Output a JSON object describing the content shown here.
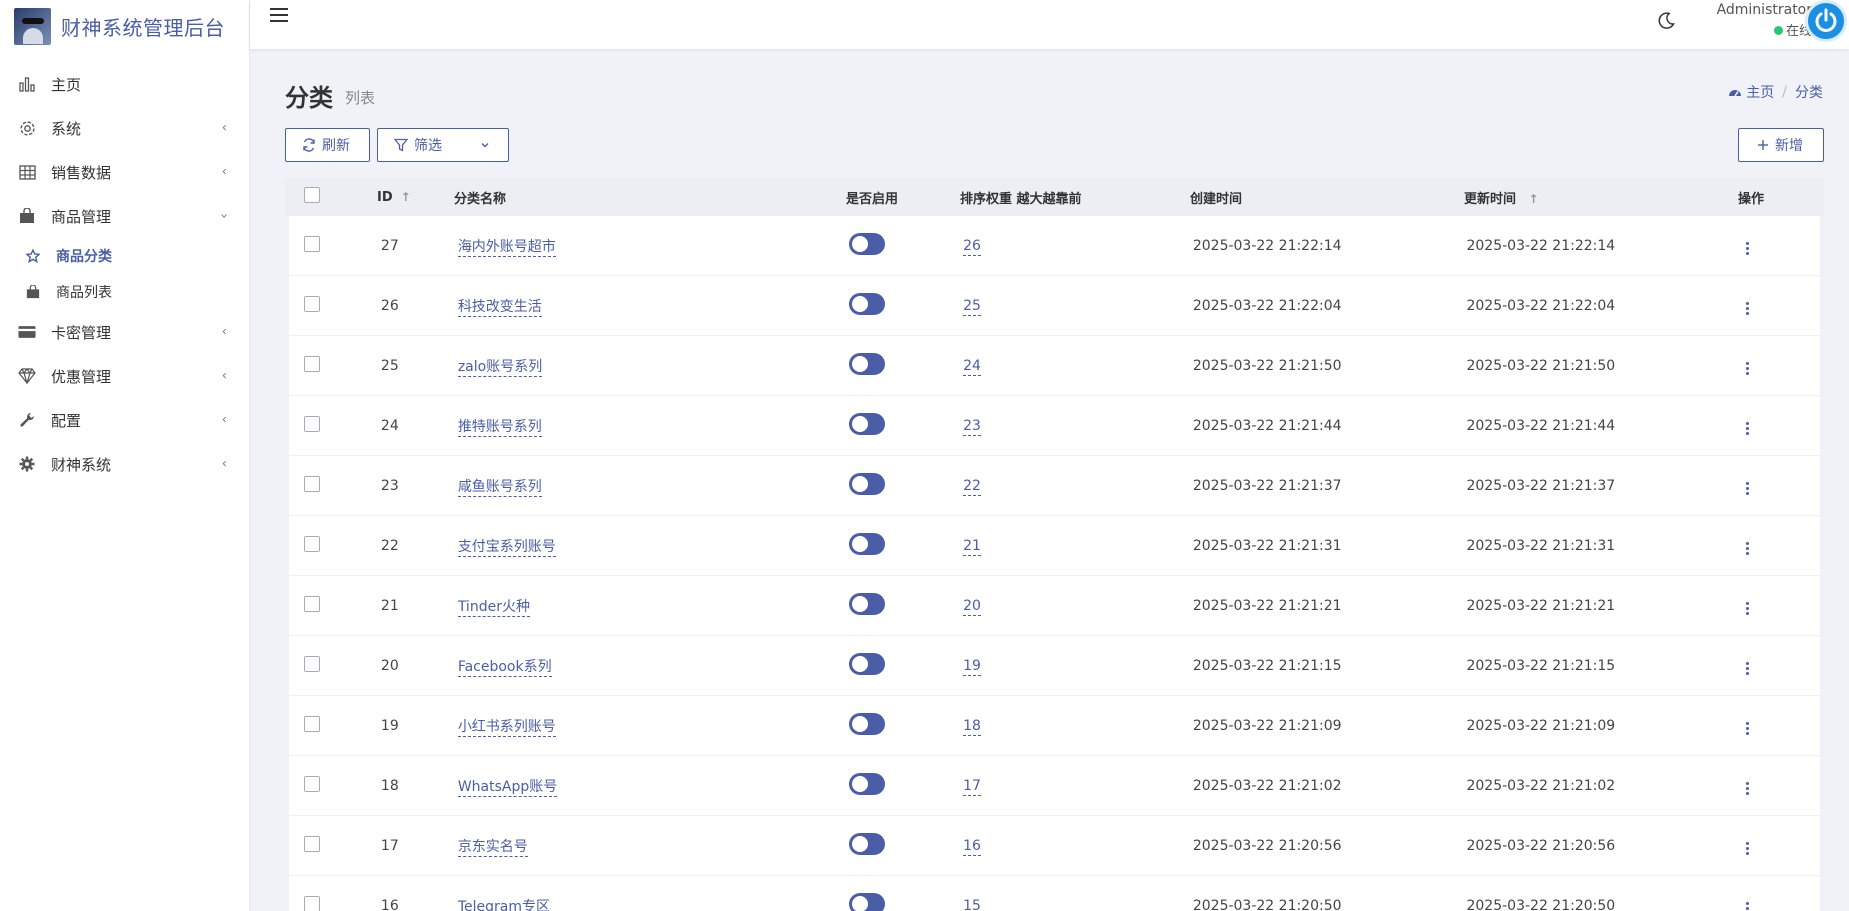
{
  "brand": {
    "title": "财神系统管理后台"
  },
  "sidebar": {
    "items": [
      {
        "label": "主页",
        "icon": "bar-chart-icon",
        "expandable": false
      },
      {
        "label": "系统",
        "icon": "gear-icon",
        "expandable": true
      },
      {
        "label": "销售数据",
        "icon": "table-icon",
        "expandable": true
      },
      {
        "label": "商品管理",
        "icon": "shopping-bag-icon",
        "expandable": true,
        "expanded": true,
        "children": [
          {
            "label": "商品分类",
            "icon": "star-icon",
            "active": true
          },
          {
            "label": "商品列表",
            "icon": "bag-icon",
            "active": false
          }
        ]
      },
      {
        "label": "卡密管理",
        "icon": "credit-card-icon",
        "expandable": true
      },
      {
        "label": "优惠管理",
        "icon": "diamond-icon",
        "expandable": true
      },
      {
        "label": "配置",
        "icon": "wrench-icon",
        "expandable": true
      },
      {
        "label": "财神系统",
        "icon": "cog-icon",
        "expandable": true
      }
    ]
  },
  "header": {
    "user_name": "Administrator",
    "user_status": "在线",
    "status_color": "#28c76f"
  },
  "page": {
    "title": "分类",
    "subtitle": "列表",
    "breadcrumb": {
      "home": "主页",
      "current": "分类"
    }
  },
  "toolbar": {
    "refresh_label": "刷新",
    "filter_label": "筛选",
    "add_label": "新增"
  },
  "table": {
    "headers": {
      "id": "ID",
      "name": "分类名称",
      "enabled": "是否启用",
      "sort": "排序权重 越大越靠前",
      "created": "创建时间",
      "updated": "更新时间",
      "ops": "操作"
    },
    "rows": [
      {
        "id": "27",
        "name": "海内外账号超市",
        "enabled": true,
        "sort": "26",
        "created": "2025-03-22 21:22:14",
        "updated": "2025-03-22 21:22:14"
      },
      {
        "id": "26",
        "name": "科技改变生活",
        "enabled": true,
        "sort": "25",
        "created": "2025-03-22 21:22:04",
        "updated": "2025-03-22 21:22:04"
      },
      {
        "id": "25",
        "name": "zalo账号系列",
        "enabled": true,
        "sort": "24",
        "created": "2025-03-22 21:21:50",
        "updated": "2025-03-22 21:21:50"
      },
      {
        "id": "24",
        "name": "推特账号系列",
        "enabled": true,
        "sort": "23",
        "created": "2025-03-22 21:21:44",
        "updated": "2025-03-22 21:21:44"
      },
      {
        "id": "23",
        "name": "咸鱼账号系列",
        "enabled": true,
        "sort": "22",
        "created": "2025-03-22 21:21:37",
        "updated": "2025-03-22 21:21:37"
      },
      {
        "id": "22",
        "name": "支付宝系列账号",
        "enabled": true,
        "sort": "21",
        "created": "2025-03-22 21:21:31",
        "updated": "2025-03-22 21:21:31"
      },
      {
        "id": "21",
        "name": "Tinder火种",
        "enabled": true,
        "sort": "20",
        "created": "2025-03-22 21:21:21",
        "updated": "2025-03-22 21:21:21"
      },
      {
        "id": "20",
        "name": "Facebook系列",
        "enabled": true,
        "sort": "19",
        "created": "2025-03-22 21:21:15",
        "updated": "2025-03-22 21:21:15"
      },
      {
        "id": "19",
        "name": "小红书系列账号",
        "enabled": true,
        "sort": "18",
        "created": "2025-03-22 21:21:09",
        "updated": "2025-03-22 21:21:09"
      },
      {
        "id": "18",
        "name": "WhatsApp账号",
        "enabled": true,
        "sort": "17",
        "created": "2025-03-22 21:21:02",
        "updated": "2025-03-22 21:21:02"
      },
      {
        "id": "17",
        "name": "京东实名号",
        "enabled": true,
        "sort": "16",
        "created": "2025-03-22 21:20:56",
        "updated": "2025-03-22 21:20:56"
      },
      {
        "id": "16",
        "name": "Telegram专区",
        "enabled": true,
        "sort": "15",
        "created": "2025-03-22 21:20:50",
        "updated": "2025-03-22 21:20:50"
      }
    ]
  },
  "colors": {
    "accent": "#4a5ea8",
    "online": "#28c76f",
    "avatar": "#1a8fe3"
  }
}
